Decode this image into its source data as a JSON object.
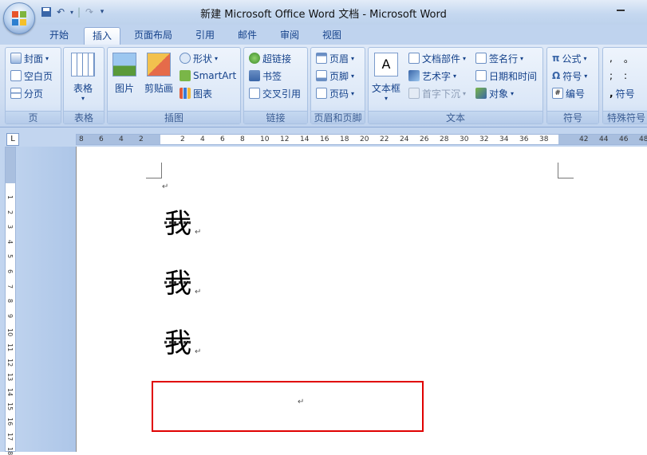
{
  "window": {
    "title": "新建 Microsoft Office Word 文档 - Microsoft Word"
  },
  "tabs": [
    "开始",
    "插入",
    "页面布局",
    "引用",
    "邮件",
    "审阅",
    "视图"
  ],
  "active_tab": "插入",
  "groups": {
    "page": {
      "label": "页",
      "items": [
        "封面",
        "空白页",
        "分页"
      ]
    },
    "table": {
      "label": "表格",
      "items": [
        "表格"
      ]
    },
    "illustrations": {
      "label": "插图",
      "items": [
        "图片",
        "剪贴画",
        "形状",
        "SmartArt",
        "图表"
      ]
    },
    "links": {
      "label": "链接",
      "items": [
        "超链接",
        "书签",
        "交叉引用"
      ]
    },
    "header_footer": {
      "label": "页眉和页脚",
      "items": [
        "页眉",
        "页脚",
        "页码"
      ]
    },
    "text": {
      "label": "文本",
      "items": [
        "文本框",
        "文档部件",
        "艺术字",
        "首字下沉",
        "签名行",
        "日期和时间",
        "对象"
      ]
    },
    "symbols": {
      "label": "符号",
      "items": [
        "公式",
        "符号",
        "编号"
      ]
    },
    "special": {
      "label": "特殊符号",
      "items": [
        "符号"
      ]
    }
  },
  "ruler": {
    "corner": "L",
    "h_ticks": [
      "8",
      "6",
      "4",
      "2",
      "2",
      "4",
      "6",
      "8",
      "10",
      "12",
      "14",
      "16",
      "18",
      "20",
      "22",
      "24",
      "26",
      "28",
      "30",
      "32",
      "34",
      "36",
      "38",
      "42",
      "44",
      "46",
      "48"
    ],
    "v_ticks": [
      "1",
      "2",
      "3",
      "4",
      "5",
      "6",
      "7",
      "8",
      "9",
      "10",
      "11",
      "12",
      "13",
      "14",
      "15",
      "16",
      "17",
      "18"
    ]
  },
  "document": {
    "lines": [
      "我",
      "我",
      "我"
    ],
    "para_mark": "↵"
  },
  "colors": {
    "highlight_box": "#e00000",
    "ribbon_text": "#15428b"
  }
}
